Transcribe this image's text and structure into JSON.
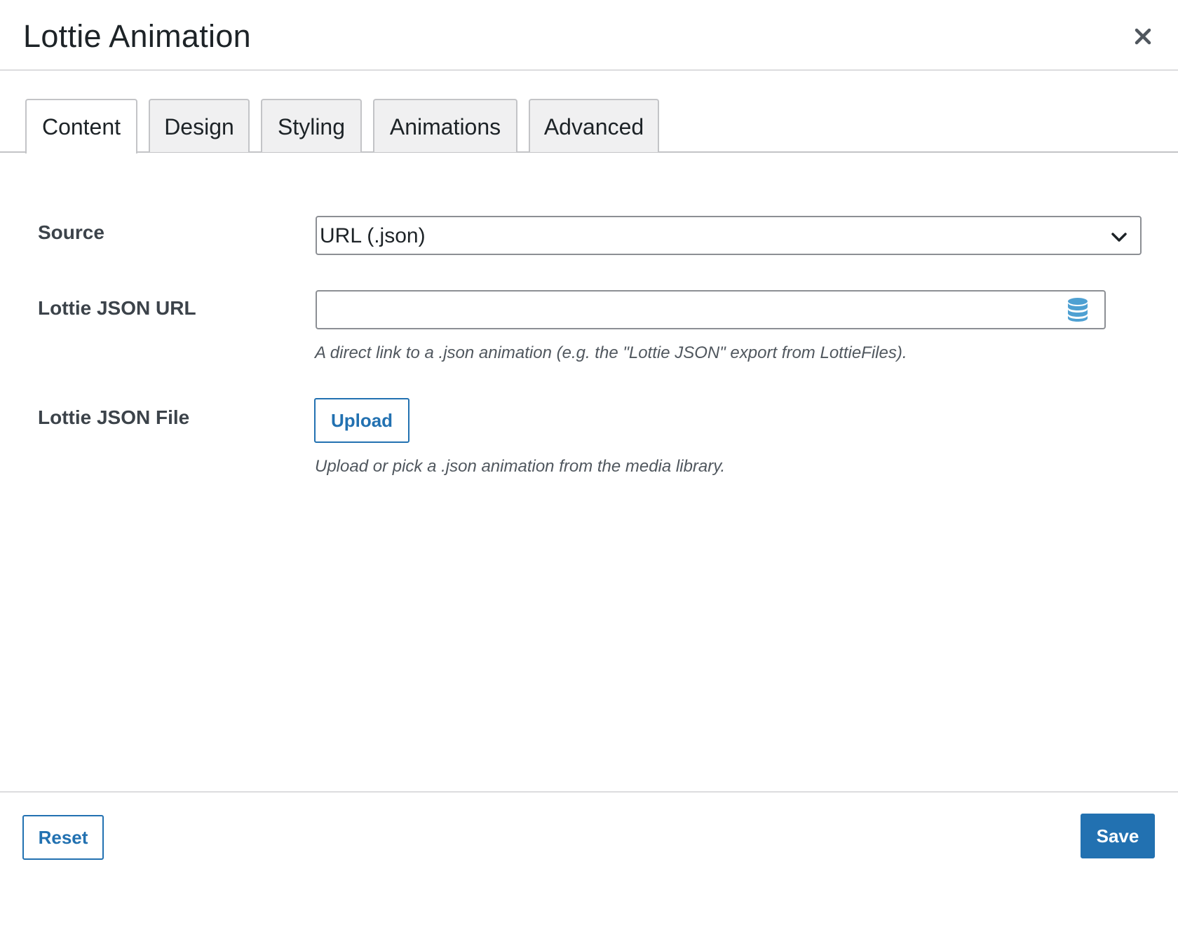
{
  "modal": {
    "title": "Lottie Animation",
    "close_icon": "close-icon"
  },
  "tabs": [
    {
      "label": "Content",
      "active": true
    },
    {
      "label": "Design",
      "active": false
    },
    {
      "label": "Styling",
      "active": false
    },
    {
      "label": "Animations",
      "active": false
    },
    {
      "label": "Advanced",
      "active": false
    }
  ],
  "fields": {
    "source": {
      "label": "Source",
      "selected": "URL (.json)",
      "icon": "chevron-down-icon"
    },
    "json_url": {
      "label": "Lottie JSON URL",
      "value": "",
      "placeholder": "",
      "icon": "database-icon",
      "help": "A direct link to a .json animation (e.g. the \"Lottie JSON\" export from LottieFiles)."
    },
    "json_file": {
      "label": "Lottie JSON File",
      "button_label": "Upload",
      "help": "Upload or pick a .json animation from the media library."
    }
  },
  "footer": {
    "reset_label": "Reset",
    "save_label": "Save"
  },
  "colors": {
    "accent": "#2271b1",
    "icon_blue": "#4ea0d2",
    "text": "#1d2327",
    "muted": "#50575e",
    "border": "#8c8f94"
  }
}
